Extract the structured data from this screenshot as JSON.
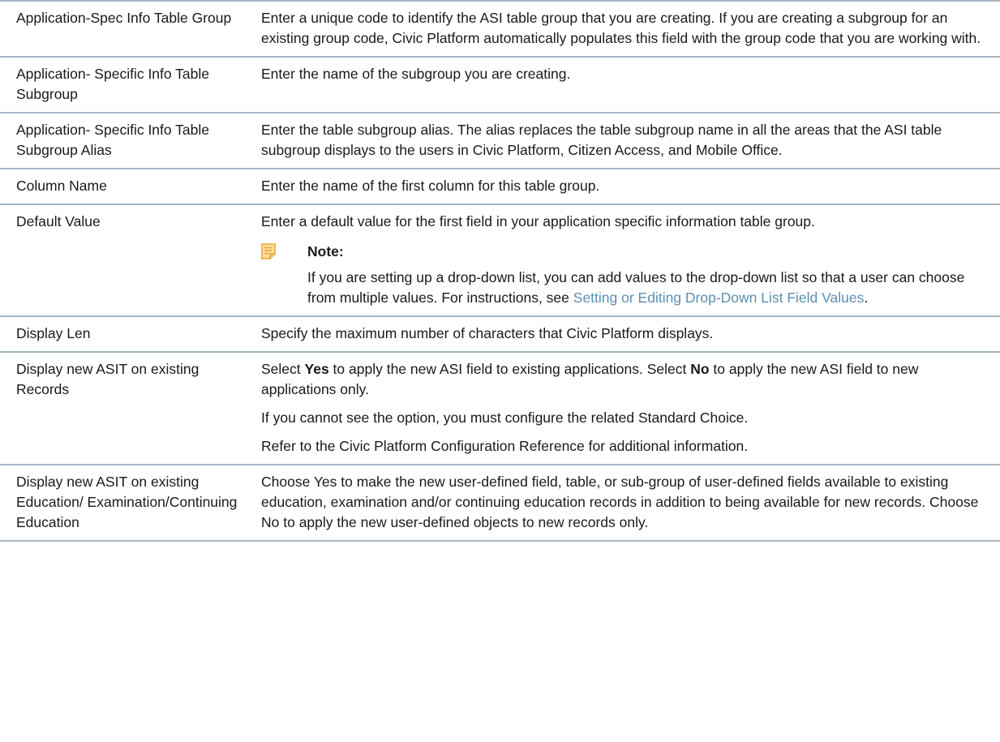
{
  "rows": [
    {
      "term": "Application-Spec Info Table Group",
      "desc": "Enter a unique code to identify the ASI table group that you are creating. If you are creating a subgroup for an existing group code, Civic Platform automatically populates this field with the group code that you are working with."
    },
    {
      "term": "Application- Specific Info Table Subgroup",
      "desc": "Enter the name of the subgroup you are creating."
    },
    {
      "term": "Application- Specific Info Table Subgroup Alias",
      "desc": "Enter the table subgroup alias. The alias replaces the table subgroup name in all the areas that the ASI table subgroup displays to the users in Civic Platform, Citizen Access, and Mobile Office."
    },
    {
      "term": "Column Name",
      "desc": "Enter the name of the first column for this table group."
    },
    {
      "term": "Default Value",
      "desc": "Enter a default value for the first field in your application specific information table group.",
      "note": {
        "icon": "note-icon",
        "title": "Note:",
        "text": "If you are setting up a drop-down list, you can add values to the drop-down list so that a user can choose from multiple values. For instructions, see ",
        "link": "Setting or Editing Drop-Down List Field Values",
        "end": "."
      }
    },
    {
      "term": "Display Len",
      "desc": "Specify the maximum number of characters that Civic Platform displays."
    },
    {
      "term": "Display new ASIT on existing Records",
      "p1": {
        "a": "Select ",
        "b1": "Yes",
        "c": " to apply the new ASI field to existing applications. Select ",
        "b2": "No",
        "d": " to apply the new ASI field to new applications only."
      },
      "p2": "If you cannot see the option, you must configure the related Standard Choice.",
      "p3": "Refer to the Civic Platform Configuration Reference for additional information."
    },
    {
      "term": "Display new ASIT on existing Education/ Examination/Continuing Education",
      "desc": "Choose Yes to make the new user-defined field, table, or sub-group of user-defined fields available to existing education, examination and/or continuing education records in addition to being available for new records. Choose No to apply the new user-defined objects to new records only."
    }
  ],
  "colors": {
    "rule": "#a5b7c2",
    "link": "#5a8fb3",
    "note_icon": "#e7a63b"
  }
}
